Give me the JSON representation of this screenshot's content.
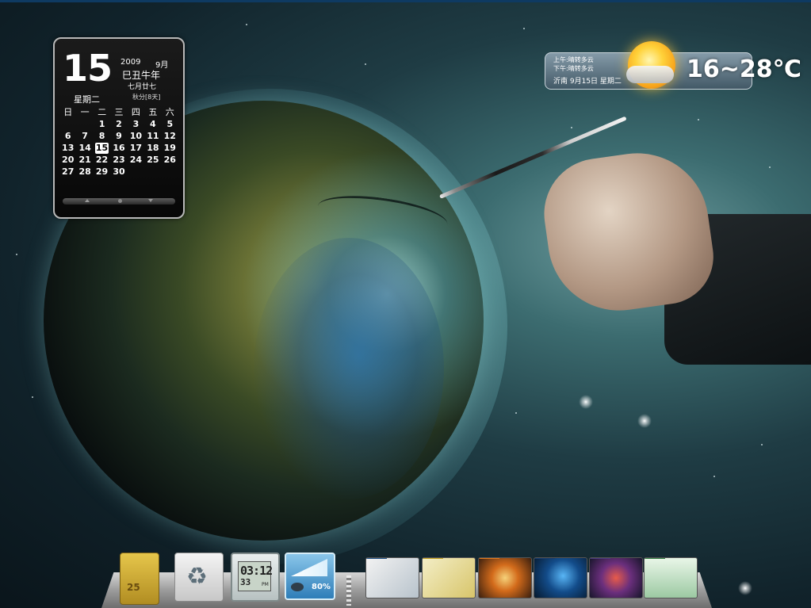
{
  "desktop": {
    "calendar_widget": {
      "day": "15",
      "weekday": "星期二",
      "year": "2009",
      "month": "9月",
      "ganzhi": "巳丑牛年",
      "lunar_date": "七月廿七",
      "solar_term": "秋分[8天]",
      "weekday_headers": [
        "日",
        "一",
        "二",
        "三",
        "四",
        "五",
        "六"
      ],
      "weeks": [
        [
          "",
          "",
          "1",
          "2",
          "3",
          "4",
          "5"
        ],
        [
          "6",
          "7",
          "8",
          "9",
          "10",
          "11",
          "12"
        ],
        [
          "13",
          "14",
          "15",
          "16",
          "17",
          "18",
          "19"
        ],
        [
          "20",
          "21",
          "22",
          "23",
          "24",
          "25",
          "26"
        ],
        [
          "27",
          "28",
          "29",
          "30",
          "",
          "",
          ""
        ]
      ],
      "today": "15"
    },
    "weather_widget": {
      "am_line": "上午:晴转多云",
      "pm_line": "下午:晴转多云",
      "city_line": "沂南  9月15日  星期二",
      "temperature": "16~28℃",
      "icon": "sunny-with-clouds-icon"
    },
    "dock": {
      "items": [
        {
          "name": "calendar-widget-icon",
          "label": "25"
        },
        {
          "name": "recycle-bin-icon",
          "label": ""
        },
        {
          "name": "clock-widget-icon",
          "time": "03:12",
          "seconds": "33",
          "ampm": "PM"
        },
        {
          "name": "battery-widget-icon",
          "percent": "80%"
        },
        {
          "name": "folder-icon",
          "label": ""
        },
        {
          "name": "folder-icon",
          "label": ""
        },
        {
          "name": "folder-icon",
          "label": ""
        },
        {
          "name": "folder-icon",
          "label": ""
        },
        {
          "name": "folder-icon",
          "label": ""
        },
        {
          "name": "folder-icon",
          "label": ""
        }
      ]
    }
  }
}
